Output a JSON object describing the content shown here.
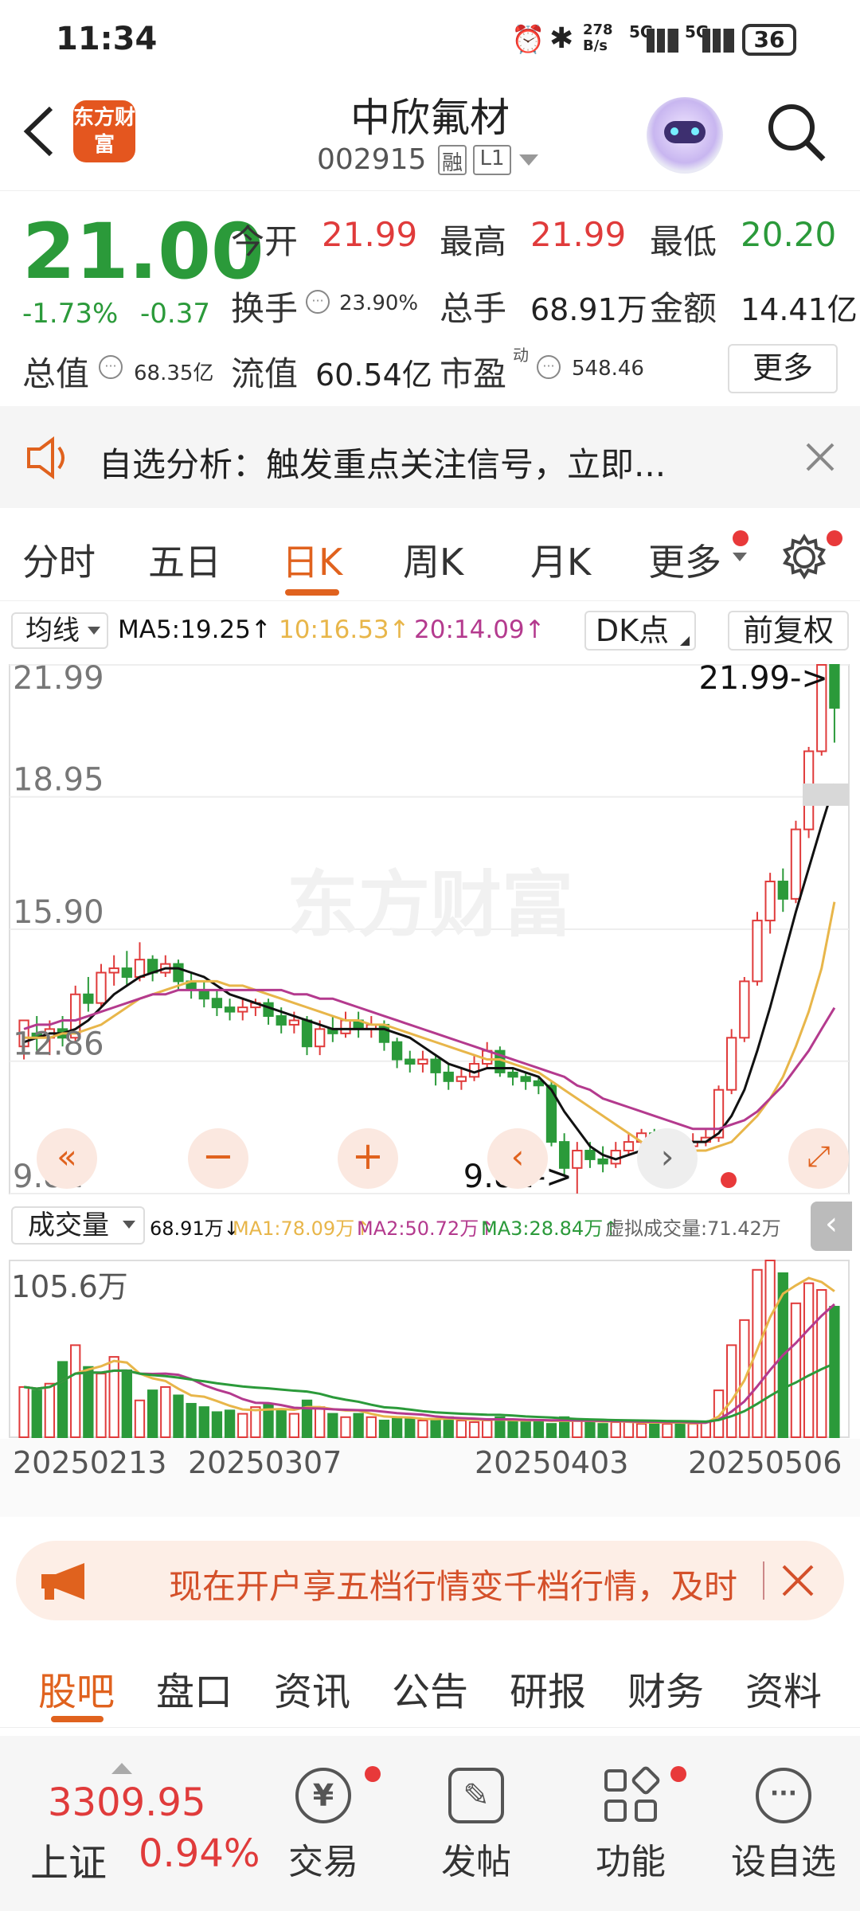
{
  "status": {
    "time": "11:34",
    "net_speed": "278 B/s",
    "network1": "5G",
    "network2": "5G",
    "battery": "36"
  },
  "header": {
    "logo_text": "东方财富",
    "stock_name": "中欣氟材",
    "stock_code": "002915",
    "tag_rong": "融",
    "tag_level": "L1"
  },
  "quote": {
    "price": "21.00",
    "change_pct": "-1.73%",
    "change": "-0.37",
    "open_label": "今开",
    "open": "21.99",
    "high_label": "最高",
    "high": "21.99",
    "low_label": "最低",
    "low": "20.20",
    "turnover_label": "换手",
    "turnover": "23.90%",
    "volume_label": "总手",
    "volume": "68.91万",
    "amount_label": "金额",
    "amount": "14.41亿",
    "mcap_label": "总值",
    "mcap": "68.35亿",
    "float_label": "流值",
    "float": "60.54亿",
    "pe_label": "市盈",
    "pe_sup": "动",
    "pe": "548.46",
    "more_label": "更多"
  },
  "banner": {
    "text": "自选分析：触发重点关注信号，立即..."
  },
  "tabs": [
    "分时",
    "五日",
    "日K",
    "周K",
    "月K",
    "更多"
  ],
  "chart_toolbar": {
    "ma_select": "均线",
    "ma5": "MA5:19.25↑",
    "ma10": "10:16.53↑",
    "ma20": "20:14.09↑",
    "dk_label": "DK点",
    "adjust_label": "前复权"
  },
  "volume_toolbar": {
    "select": "成交量",
    "vol": "68.91万↓",
    "ma1": "MA1:78.09万↑",
    "ma2": "MA2:50.72万↑",
    "ma3": "MA3:28.84万↑",
    "virtual": "虚拟成交量:71.42万"
  },
  "colors": {
    "up": "#e03b3b",
    "down": "#2b9a3a",
    "ma5": "#111111",
    "ma10": "#e8b64a",
    "ma20": "#b43a8e",
    "accent": "#e0621e"
  },
  "chart_data": {
    "type": "candlestick",
    "y_ticks": [
      "21.99",
      "18.95",
      "15.90",
      "12.86",
      "9.81"
    ],
    "ylim": [
      9.81,
      21.99
    ],
    "high_annotation": "21.99->",
    "low_annotation": "9.81->",
    "volume_max_label": "105.6万",
    "x_labels": [
      "20250213",
      "20250307",
      "20250403",
      "20250506"
    ],
    "candles": [
      [
        13.2,
        13.8,
        12.9,
        13.5
      ],
      [
        13.5,
        13.4,
        13.1,
        13.9
      ],
      [
        13.4,
        13.6,
        13.0,
        13.8
      ],
      [
        13.6,
        13.4,
        13.2,
        13.9
      ],
      [
        13.4,
        14.4,
        13.3,
        14.6
      ],
      [
        14.4,
        14.2,
        14.0,
        14.8
      ],
      [
        14.2,
        14.9,
        14.1,
        15.1
      ],
      [
        14.9,
        15.0,
        14.6,
        15.3
      ],
      [
        15.0,
        14.8,
        14.6,
        15.4
      ],
      [
        14.8,
        15.2,
        14.7,
        15.6
      ],
      [
        15.2,
        14.9,
        14.7,
        15.3
      ],
      [
        14.9,
        15.1,
        14.8,
        15.3
      ],
      [
        15.1,
        14.7,
        14.5,
        15.2
      ],
      [
        14.7,
        14.5,
        14.3,
        14.9
      ],
      [
        14.5,
        14.3,
        14.1,
        14.7
      ],
      [
        14.3,
        14.1,
        13.9,
        14.5
      ],
      [
        14.1,
        14.0,
        13.8,
        14.3
      ],
      [
        14.0,
        14.1,
        13.8,
        14.3
      ],
      [
        14.1,
        14.2,
        13.9,
        14.3
      ],
      [
        14.2,
        13.9,
        13.7,
        14.3
      ],
      [
        13.9,
        13.7,
        13.5,
        14.1
      ],
      [
        13.7,
        13.8,
        13.5,
        14.0
      ],
      [
        13.8,
        13.2,
        13.0,
        13.9
      ],
      [
        13.2,
        13.6,
        13.0,
        13.8
      ],
      [
        13.6,
        13.5,
        13.3,
        13.9
      ],
      [
        13.5,
        13.8,
        13.4,
        14.0
      ],
      [
        13.8,
        13.6,
        13.4,
        14.0
      ],
      [
        13.6,
        13.7,
        13.4,
        13.9
      ],
      [
        13.7,
        13.3,
        13.1,
        13.8
      ],
      [
        13.3,
        12.9,
        12.7,
        13.4
      ],
      [
        12.9,
        12.8,
        12.6,
        13.1
      ],
      [
        12.8,
        12.9,
        12.6,
        13.1
      ],
      [
        12.9,
        12.6,
        12.3,
        13.0
      ],
      [
        12.6,
        12.4,
        12.2,
        12.8
      ],
      [
        12.4,
        12.5,
        12.2,
        12.7
      ],
      [
        12.5,
        12.8,
        12.4,
        13.0
      ],
      [
        12.8,
        13.1,
        12.7,
        13.3
      ],
      [
        13.1,
        12.6,
        12.5,
        13.2
      ],
      [
        12.6,
        12.5,
        12.3,
        12.7
      ],
      [
        12.5,
        12.4,
        12.2,
        12.6
      ],
      [
        12.4,
        12.3,
        12.1,
        12.5
      ],
      [
        12.3,
        11.0,
        10.9,
        12.4
      ],
      [
        11.0,
        10.4,
        10.2,
        11.2
      ],
      [
        10.4,
        10.8,
        9.81,
        11.0
      ],
      [
        10.8,
        10.6,
        10.4,
        11.0
      ],
      [
        10.6,
        10.5,
        10.3,
        10.9
      ],
      [
        10.5,
        10.8,
        10.4,
        11.0
      ],
      [
        10.8,
        11.0,
        10.7,
        11.2
      ],
      [
        11.0,
        11.2,
        10.9,
        11.3
      ],
      [
        11.2,
        10.9,
        10.8,
        11.3
      ],
      [
        10.9,
        11.0,
        10.8,
        11.2
      ],
      [
        11.0,
        10.9,
        10.7,
        11.1
      ],
      [
        10.9,
        11.0,
        10.8,
        11.2
      ],
      [
        11.0,
        11.1,
        10.9,
        11.3
      ],
      [
        11.1,
        12.2,
        11.0,
        12.3
      ],
      [
        12.2,
        13.4,
        12.1,
        13.6
      ],
      [
        13.4,
        14.7,
        13.3,
        14.8
      ],
      [
        14.7,
        16.1,
        14.6,
        16.3
      ],
      [
        16.1,
        17.0,
        15.8,
        17.2
      ],
      [
        17.0,
        16.6,
        16.3,
        17.3
      ],
      [
        16.6,
        18.2,
        16.5,
        18.4
      ],
      [
        18.2,
        20.0,
        18.0,
        20.1
      ],
      [
        20.0,
        21.99,
        19.9,
        21.99
      ],
      [
        21.99,
        21.0,
        20.2,
        21.99
      ]
    ],
    "ma5": [
      13.3,
      13.4,
      13.5,
      13.5,
      13.6,
      13.8,
      14.1,
      14.4,
      14.6,
      14.8,
      14.9,
      15.0,
      15.0,
      14.9,
      14.8,
      14.6,
      14.4,
      14.3,
      14.2,
      14.1,
      14.0,
      13.9,
      13.8,
      13.7,
      13.6,
      13.6,
      13.6,
      13.6,
      13.6,
      13.5,
      13.4,
      13.2,
      13.0,
      12.8,
      12.7,
      12.6,
      12.7,
      12.7,
      12.7,
      12.6,
      12.5,
      12.2,
      11.7,
      11.3,
      10.9,
      10.7,
      10.6,
      10.7,
      10.8,
      10.9,
      10.9,
      11.0,
      11.0,
      11.0,
      11.2,
      11.6,
      12.2,
      13.1,
      14.1,
      15.2,
      16.3,
      17.3,
      18.3,
      19.25
    ],
    "ma10": [
      13.4,
      13.4,
      13.4,
      13.5,
      13.5,
      13.6,
      13.7,
      13.9,
      14.1,
      14.3,
      14.4,
      14.5,
      14.6,
      14.7,
      14.7,
      14.7,
      14.6,
      14.6,
      14.5,
      14.4,
      14.3,
      14.2,
      14.1,
      14.0,
      13.9,
      13.8,
      13.8,
      13.7,
      13.7,
      13.6,
      13.5,
      13.4,
      13.3,
      13.2,
      13.1,
      13.0,
      12.9,
      12.9,
      12.8,
      12.7,
      12.6,
      12.4,
      12.2,
      12.0,
      11.8,
      11.6,
      11.4,
      11.2,
      11.0,
      10.9,
      10.8,
      10.8,
      10.8,
      10.8,
      10.9,
      11.0,
      11.3,
      11.6,
      12.0,
      12.5,
      13.2,
      14.0,
      15.0,
      16.53
    ],
    "ma20": [
      13.6,
      13.7,
      13.7,
      13.8,
      13.8,
      13.9,
      14.0,
      14.1,
      14.2,
      14.3,
      14.4,
      14.4,
      14.5,
      14.5,
      14.5,
      14.5,
      14.5,
      14.5,
      14.5,
      14.5,
      14.5,
      14.4,
      14.4,
      14.3,
      14.3,
      14.2,
      14.1,
      14.0,
      13.9,
      13.8,
      13.7,
      13.6,
      13.5,
      13.4,
      13.3,
      13.2,
      13.1,
      13.0,
      12.9,
      12.8,
      12.7,
      12.6,
      12.5,
      12.3,
      12.2,
      12.0,
      11.9,
      11.8,
      11.7,
      11.6,
      11.5,
      11.4,
      11.3,
      11.3,
      11.3,
      11.4,
      11.5,
      11.7,
      12.0,
      12.3,
      12.7,
      13.1,
      13.6,
      14.09
    ],
    "volumes": [
      30,
      28,
      32,
      45,
      55,
      42,
      38,
      48,
      40,
      22,
      28,
      30,
      25,
      20,
      18,
      15,
      16,
      14,
      18,
      20,
      16,
      14,
      22,
      18,
      14,
      12,
      14,
      12,
      10,
      12,
      11,
      10,
      11,
      12,
      10,
      9,
      10,
      12,
      10,
      9,
      10,
      8,
      12,
      10,
      9,
      8,
      9,
      10,
      8,
      9,
      8,
      9,
      8,
      9,
      28,
      55,
      70,
      100,
      105.6,
      98,
      80,
      92,
      88,
      78
    ]
  },
  "ad": {
    "text": "现在开户享五档行情变千档行情，及时"
  },
  "subtabs": [
    "股吧",
    "盘口",
    "资讯",
    "公告",
    "研报",
    "财务",
    "资料"
  ],
  "bottom": {
    "index_value": "3309.95",
    "index_name": "上证",
    "index_change": "0.94%",
    "trade": "交易",
    "post": "发帖",
    "func": "功能",
    "add": "设自选"
  }
}
